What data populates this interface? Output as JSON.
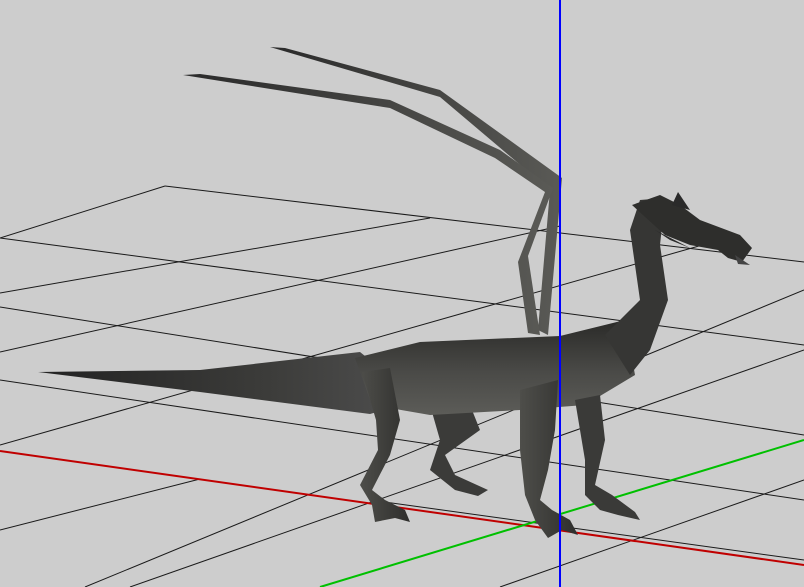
{
  "viewport": {
    "background": "#cdcdcd",
    "model": "dragon",
    "model_color": "#3d3d3b",
    "grid_color": "#1a1a1a"
  },
  "axes": {
    "x": {
      "color": "#c00000"
    },
    "y": {
      "color": "#00c000"
    },
    "z": {
      "color": "#0000ff"
    }
  }
}
